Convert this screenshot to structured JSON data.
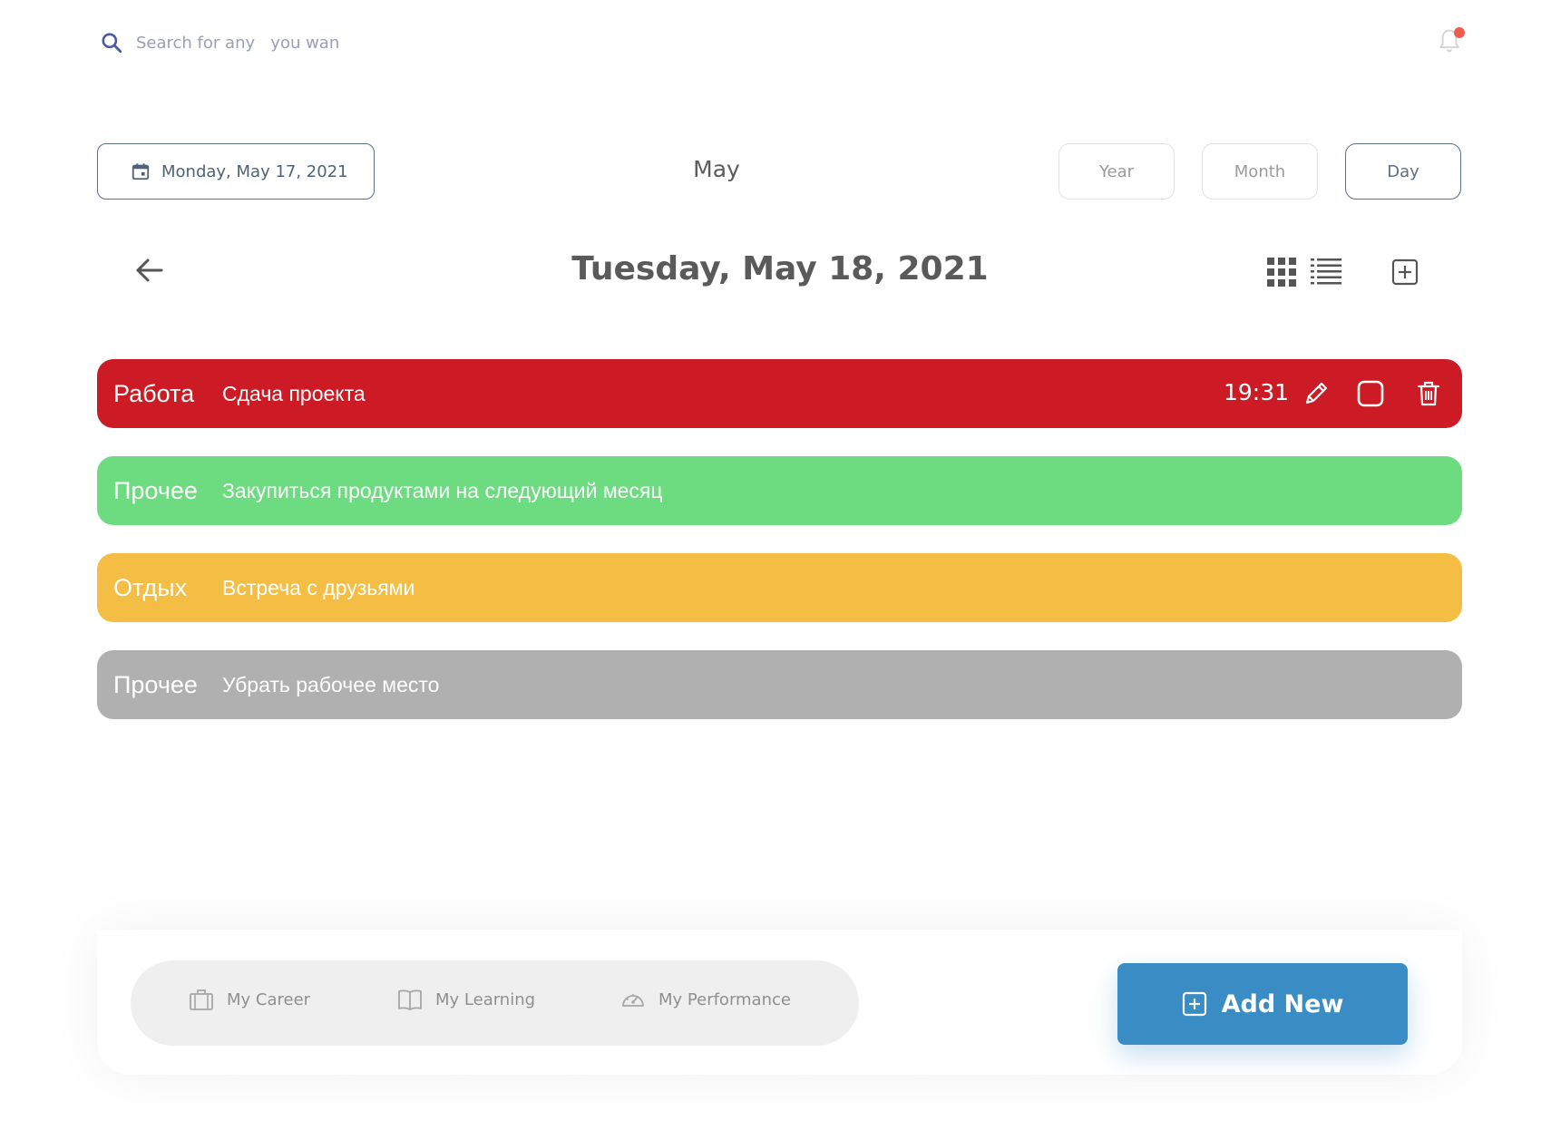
{
  "search": {
    "placeholder": "Search for any   you wan"
  },
  "notifications": {
    "has_unread": true,
    "dot_color": "#ef5b4c"
  },
  "date_picker": {
    "label": "Monday, May 17, 2021"
  },
  "calendar": {
    "month_title": "May",
    "day_title": "Tuesday, May 18, 2021"
  },
  "view_buttons": {
    "year": "Year",
    "month": "Month",
    "day": "Day",
    "selected": "Day"
  },
  "events": [
    {
      "category": "Работа",
      "title": "Сдача проекта",
      "time": "19:31",
      "color": "#cc1b24"
    },
    {
      "category": "Прочее",
      "title": "Закупиться продуктами на следующий месяц",
      "time": "",
      "color": "#6ddb7f"
    },
    {
      "category": "Отдых",
      "title": "Встреча с друзьями",
      "time": "",
      "color": "#f4bd43"
    },
    {
      "category": "Прочее",
      "title": "Убрать рабочее место",
      "time": "",
      "color": "#b0b0b0"
    }
  ],
  "bottom_nav": {
    "career": "My Career",
    "learning": "My Learning",
    "performance": "My Performance"
  },
  "add_new_label": "Add New",
  "colors": {
    "accent": "#3a8dc4",
    "outline": "#5d6f86"
  }
}
